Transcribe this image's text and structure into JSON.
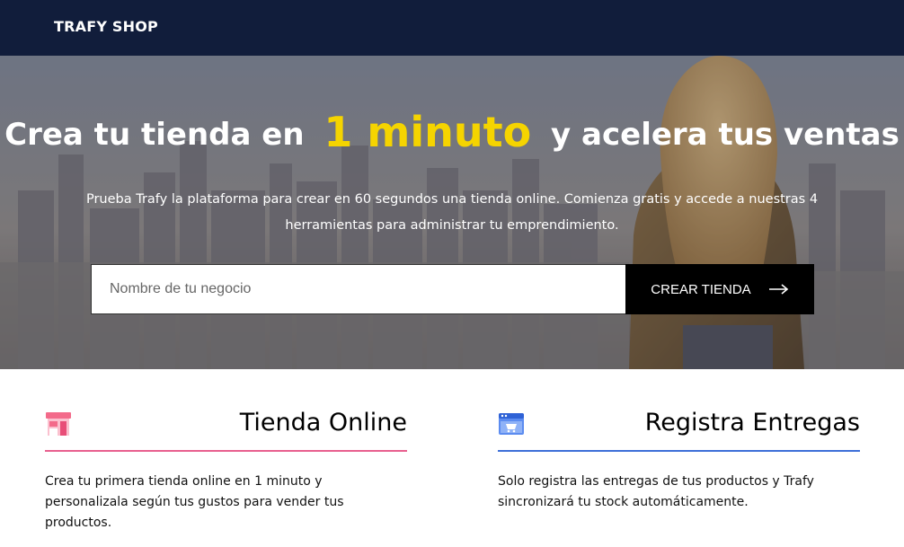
{
  "header": {
    "brand": "TRAFY SHOP"
  },
  "hero": {
    "headline_before": "Crea tu tienda en",
    "headline_accent": "1 minuto",
    "headline_after": "y acelera tus ventas",
    "subtitle": "Prueba Trafy la plataforma para crear en 60 segundos una tienda online. Comienza gratis y accede a nuestras 4 herramientas para administrar tu emprendimiento.",
    "input_placeholder": "Nombre de tu negocio",
    "input_value": "",
    "cta_label": "CREAR TIENDA",
    "cta_icon": "arrow-right-icon",
    "accent_color": "#f5d400"
  },
  "features": [
    {
      "icon": "storefront-icon",
      "title": "Tienda Online",
      "description": "Crea tu primera tienda online en 1 minuto y personalizala según tus gustos para vender tus productos.",
      "rule_color": "#e8608f"
    },
    {
      "icon": "browser-cart-icon",
      "title": "Registra Entregas",
      "description": "Solo registra las entregas de tus productos y Trafy sincronizará tu stock automáticamente.",
      "rule_color": "#3d6fd8"
    }
  ],
  "colors": {
    "header_bg": "#111d3b",
    "cta_bg": "#000000"
  }
}
